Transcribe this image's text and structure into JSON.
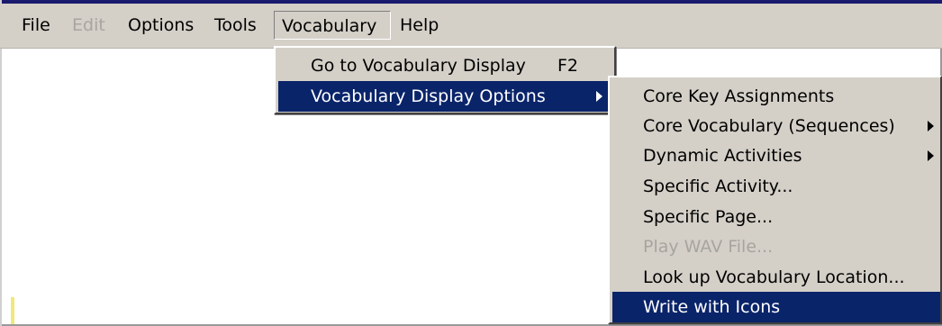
{
  "menubar": {
    "items": [
      {
        "label": "File",
        "enabled": true
      },
      {
        "label": "Edit",
        "enabled": false
      },
      {
        "label": "Options",
        "enabled": true
      },
      {
        "label": "Tools",
        "enabled": true
      },
      {
        "label": "Vocabulary",
        "enabled": true,
        "open": true
      },
      {
        "label": "Help",
        "enabled": true
      }
    ]
  },
  "vocabulary_menu": {
    "items": [
      {
        "label": "Go to Vocabulary Display",
        "shortcut": "F2"
      },
      {
        "label": "Vocabulary Display Options",
        "selected": true,
        "has_submenu": true
      }
    ]
  },
  "display_options_submenu": {
    "items": [
      {
        "label": "Core Key Assignments"
      },
      {
        "label": "Core Vocabulary (Sequences)",
        "has_submenu": true
      },
      {
        "label": "Dynamic Activities",
        "has_submenu": true
      },
      {
        "label": "Specific Activity..."
      },
      {
        "label": "Specific Page..."
      },
      {
        "label": "Play WAV File...",
        "enabled": false
      },
      {
        "label": "Look up Vocabulary Location..."
      },
      {
        "label": "Write with Icons",
        "selected": true
      }
    ]
  },
  "colors": {
    "menu_face": "#d4d0c8",
    "highlight": "#0a246a",
    "highlight_text": "#ffffff",
    "disabled_text": "#a8a5a0"
  },
  "icons": {
    "submenu_arrow": "submenu-arrow-icon"
  }
}
